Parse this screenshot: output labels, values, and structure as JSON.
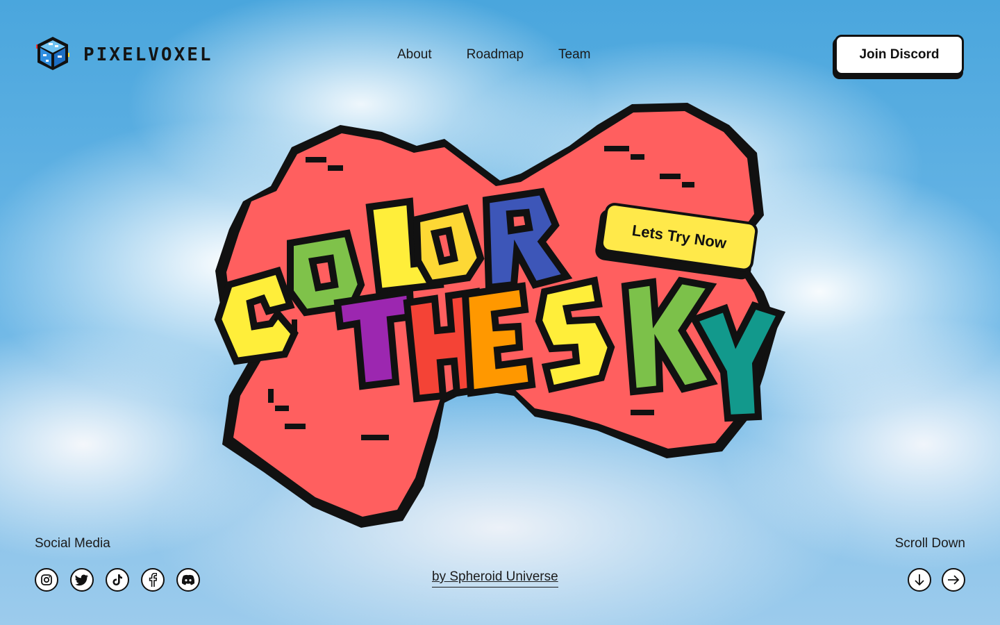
{
  "brand": {
    "name": "PIXELVOXEL",
    "logo_icon": "pixel-cube-icon"
  },
  "nav": {
    "items": [
      {
        "label": "About"
      },
      {
        "label": "Roadmap"
      },
      {
        "label": "Team"
      }
    ]
  },
  "header": {
    "cta_label": "Join Discord"
  },
  "hero": {
    "headline_line1": "COLOR",
    "headline_line2": "THESKY",
    "cta_label": "Lets Try Now",
    "letter_colors": [
      "#ffee3a",
      "#7fc24a",
      "#ffee3a",
      "#fdd835",
      "#3d56b8",
      "#9c27b0",
      "#f44336",
      "#ff9800",
      "#ffee3a",
      "#7cc14a",
      "#12998c"
    ],
    "cloud_color": "#ff5f5f"
  },
  "footer": {
    "social_label": "Social Media",
    "socials": [
      {
        "icon": "instagram-icon"
      },
      {
        "icon": "twitter-icon"
      },
      {
        "icon": "tiktok-icon"
      },
      {
        "icon": "facebook-icon"
      },
      {
        "icon": "discord-icon"
      }
    ],
    "credit": "by Spheroid Universe",
    "scroll_label": "Scroll Down",
    "arrows": [
      {
        "icon": "arrow-down-icon"
      },
      {
        "icon": "arrow-right-icon"
      }
    ]
  }
}
